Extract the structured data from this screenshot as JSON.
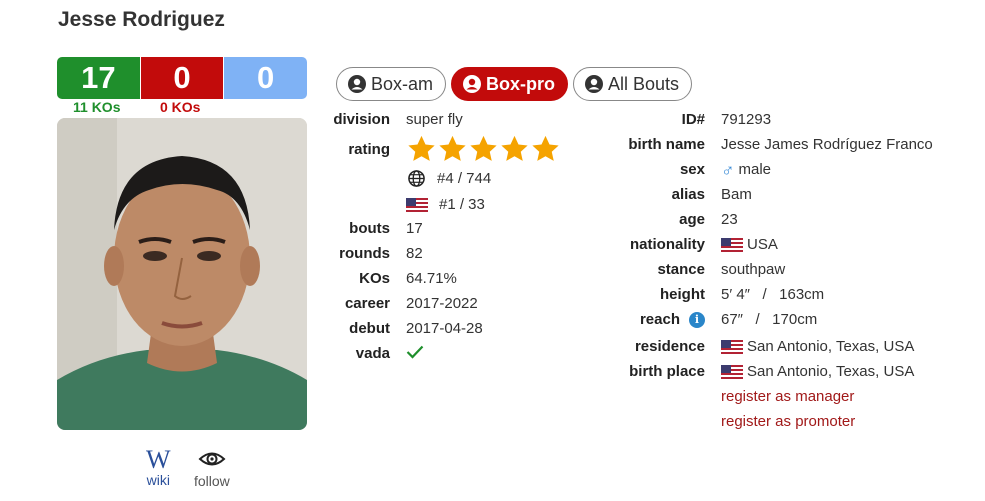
{
  "profile": {
    "name": "Jesse Rodriguez"
  },
  "record": {
    "wins": "17",
    "losses": "0",
    "draws": "0",
    "win_kos": "11 KOs",
    "loss_kos": "0 KOs"
  },
  "colors": {
    "win": "#1f8f2c",
    "loss": "#c20b0b",
    "draw": "#7fb2f5",
    "link": "#a11919"
  },
  "links": {
    "wiki": "wiki",
    "follow": "follow"
  },
  "tabs": [
    {
      "label": "Box-am",
      "active": false
    },
    {
      "label": "Box-pro",
      "active": true
    },
    {
      "label": "All Bouts",
      "active": false
    }
  ],
  "left_stats": {
    "division_label": "division",
    "division": "super fly",
    "rating_label": "rating",
    "rating_stars": 5,
    "world_rank": "#4 / 744",
    "country_rank": "#1 / 33",
    "bouts_label": "bouts",
    "bouts": "17",
    "rounds_label": "rounds",
    "rounds": "82",
    "kos_label": "KOs",
    "kos": "64.71%",
    "career_label": "career",
    "career": "2017-2022",
    "debut_label": "debut",
    "debut": "2017-04-28",
    "vada_label": "vada"
  },
  "right_stats": {
    "id_label": "ID#",
    "id": "791293",
    "birth_name_label": "birth name",
    "birth_name": "Jesse James Rodríguez Franco",
    "sex_label": "sex",
    "sex": "male",
    "alias_label": "alias",
    "alias": "Bam",
    "age_label": "age",
    "age": "23",
    "nationality_label": "nationality",
    "nationality": "USA",
    "stance_label": "stance",
    "stance": "southpaw",
    "height_label": "height",
    "height": "5′ 4″   /   163cm",
    "reach_label": "reach",
    "reach": "67″   /   170cm",
    "residence_label": "residence",
    "residence": "San Antonio, Texas, USA",
    "birth_place_label": "birth place",
    "birth_place": "San Antonio, Texas, USA",
    "register_manager": "register as manager",
    "register_promoter": "register as promoter"
  }
}
